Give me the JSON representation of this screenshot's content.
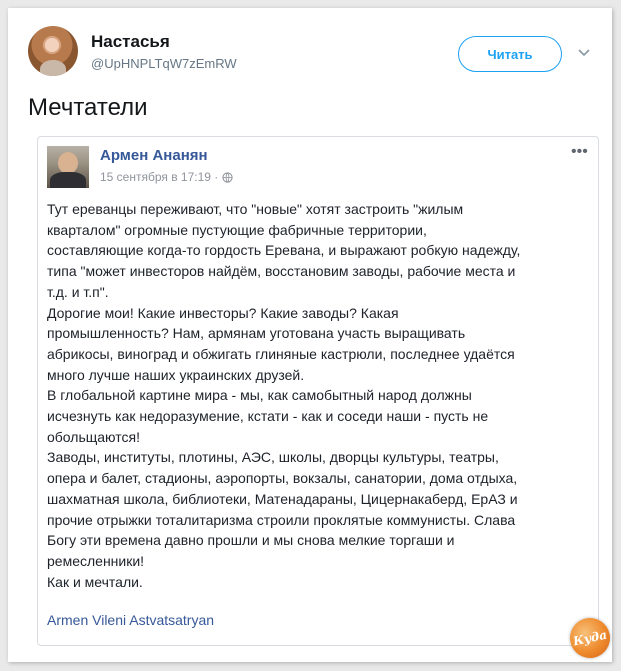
{
  "tweet": {
    "author_name": "Настасья",
    "author_handle": "@UpHNPLTqW7zEmRW",
    "follow_label": "Читать",
    "text": "Мечтатели"
  },
  "fb_post": {
    "author_name": "Армен Ананян",
    "timestamp": "15 сентября в 17:19 ·",
    "more_label": "•••",
    "lines": [
      "Тут ереванцы переживают, что \"новые\" хотят застроить \"жилым",
      "кварталом\" огромные пустующие фабричные территории,",
      "составляющие когда-то гордость Еревана, и выражают робкую надежду,",
      "типа \"может инвесторов найдём, восстановим заводы, рабочие места и",
      "т.д. и т.п\".",
      "Дорогие мои! Какие инвесторы? Какие заводы? Какая",
      "промышленность? Нам, армянам уготована участь выращивать",
      "абрикосы, виноград и обжигать глиняные кастрюли, последнее удаётся",
      "много лучше наших украинских друзей.",
      "В глобальной картине мира - мы, как самобытный народ должны",
      "исчезнуть как недоразумение, кстати - как и соседи наши - пусть не",
      "обольщаются!",
      "Заводы, институты, плотины, АЭС, школы, дворцы культуры, театры,",
      "опера и балет, стадионы, аэропорты, вокзалы, санатории, дома отдыха,",
      "шахматная школа, библиотеки, Матенадараны, Цицернакаберд, ЕрАЗ и",
      "прочие отрыжки тоталитаризма строили проклятые коммунисты. Слава",
      "Богу эти времена давно прошли и мы снова мелкие торгаши и",
      "ремесленники!",
      "Как и мечтали."
    ],
    "signature": "Armen Vileni Astvatsatryan"
  },
  "watermark_text": "Куда",
  "colors": {
    "twitter_blue": "#1da1f2",
    "fb_link_blue": "#365899",
    "text_dark": "#1d2129",
    "muted": "#90949c"
  }
}
